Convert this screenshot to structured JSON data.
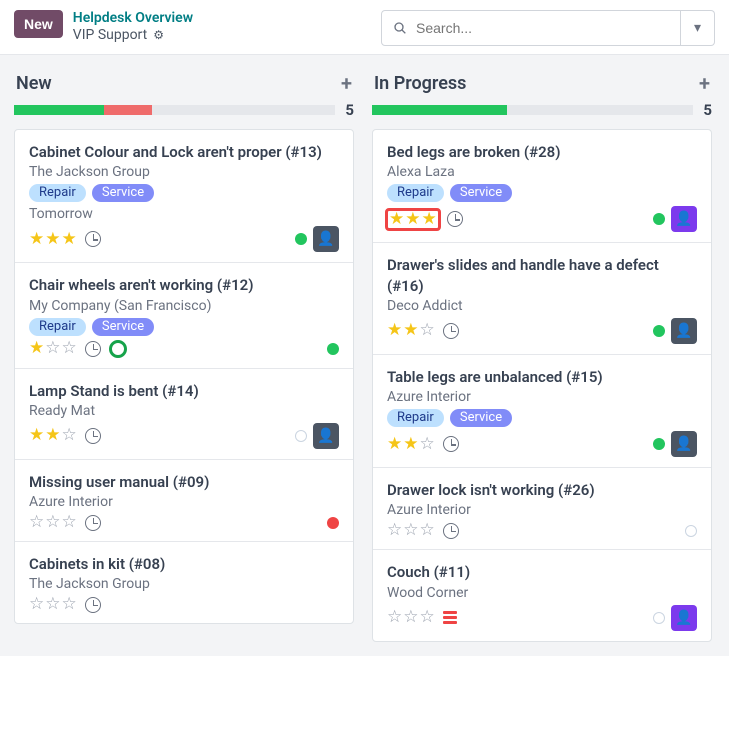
{
  "header": {
    "new_button": "New",
    "breadcrumb_title": "Helpdesk Overview",
    "breadcrumb_sub": "VIP Support",
    "search_placeholder": "Search..."
  },
  "columns": [
    {
      "title": "New",
      "count": "5",
      "bar": {
        "green_pct": 28,
        "red_pct": 15
      },
      "cards": [
        {
          "title": "Cabinet Colour and Lock aren't proper (#13)",
          "customer": "The Jackson Group",
          "tags": [
            "Repair",
            "Service"
          ],
          "extra": "Tomorrow",
          "stars": 3,
          "dot": "green",
          "avatar": "a1",
          "highlight_stars": false
        },
        {
          "title": "Chair wheels aren't working (#12)",
          "customer": "My Company (San Francisco)",
          "tags": [
            "Repair",
            "Service"
          ],
          "extra": "",
          "stars": 1,
          "dot": "green",
          "avatar": "",
          "lifesaver": true
        },
        {
          "title": "Lamp Stand is bent (#14)",
          "customer": "Ready Mat",
          "tags": [],
          "extra": "",
          "stars": 2,
          "dot": "grey",
          "avatar": "a1"
        },
        {
          "title": "Missing user manual (#09)",
          "customer": "Azure Interior",
          "tags": [],
          "extra": "",
          "stars": 0,
          "dot": "red",
          "avatar": ""
        },
        {
          "title": "Cabinets in kit (#08)",
          "customer": "The Jackson Group",
          "tags": [],
          "extra": "",
          "stars": 0,
          "dot": "",
          "avatar": ""
        }
      ]
    },
    {
      "title": "In Progress",
      "count": "5",
      "bar": {
        "green_pct": 42,
        "red_pct": 0
      },
      "cards": [
        {
          "title": "Bed legs are broken (#28)",
          "customer": "Alexa Laza",
          "tags": [
            "Repair",
            "Service"
          ],
          "extra": "",
          "stars": 3,
          "dot": "green",
          "avatar": "a2",
          "highlight_stars": true
        },
        {
          "title": "Drawer's slides and handle have a defect (#16)",
          "customer": "Deco Addict",
          "tags": [],
          "extra": "",
          "stars": 2,
          "dot": "green",
          "avatar": "a1"
        },
        {
          "title": "Table legs are unbalanced (#15)",
          "customer": "Azure Interior",
          "tags": [
            "Repair",
            "Service"
          ],
          "extra": "",
          "stars": 2,
          "dot": "green",
          "avatar": "a1"
        },
        {
          "title": "Drawer lock isn't working (#26)",
          "customer": "Azure Interior",
          "tags": [],
          "extra": "",
          "stars": 0,
          "dot": "grey",
          "avatar": ""
        },
        {
          "title": "Couch (#11)",
          "customer": "Wood Corner",
          "tags": [],
          "extra": "",
          "stars": 0,
          "dot": "grey",
          "avatar": "a2",
          "danger": true
        }
      ]
    }
  ]
}
